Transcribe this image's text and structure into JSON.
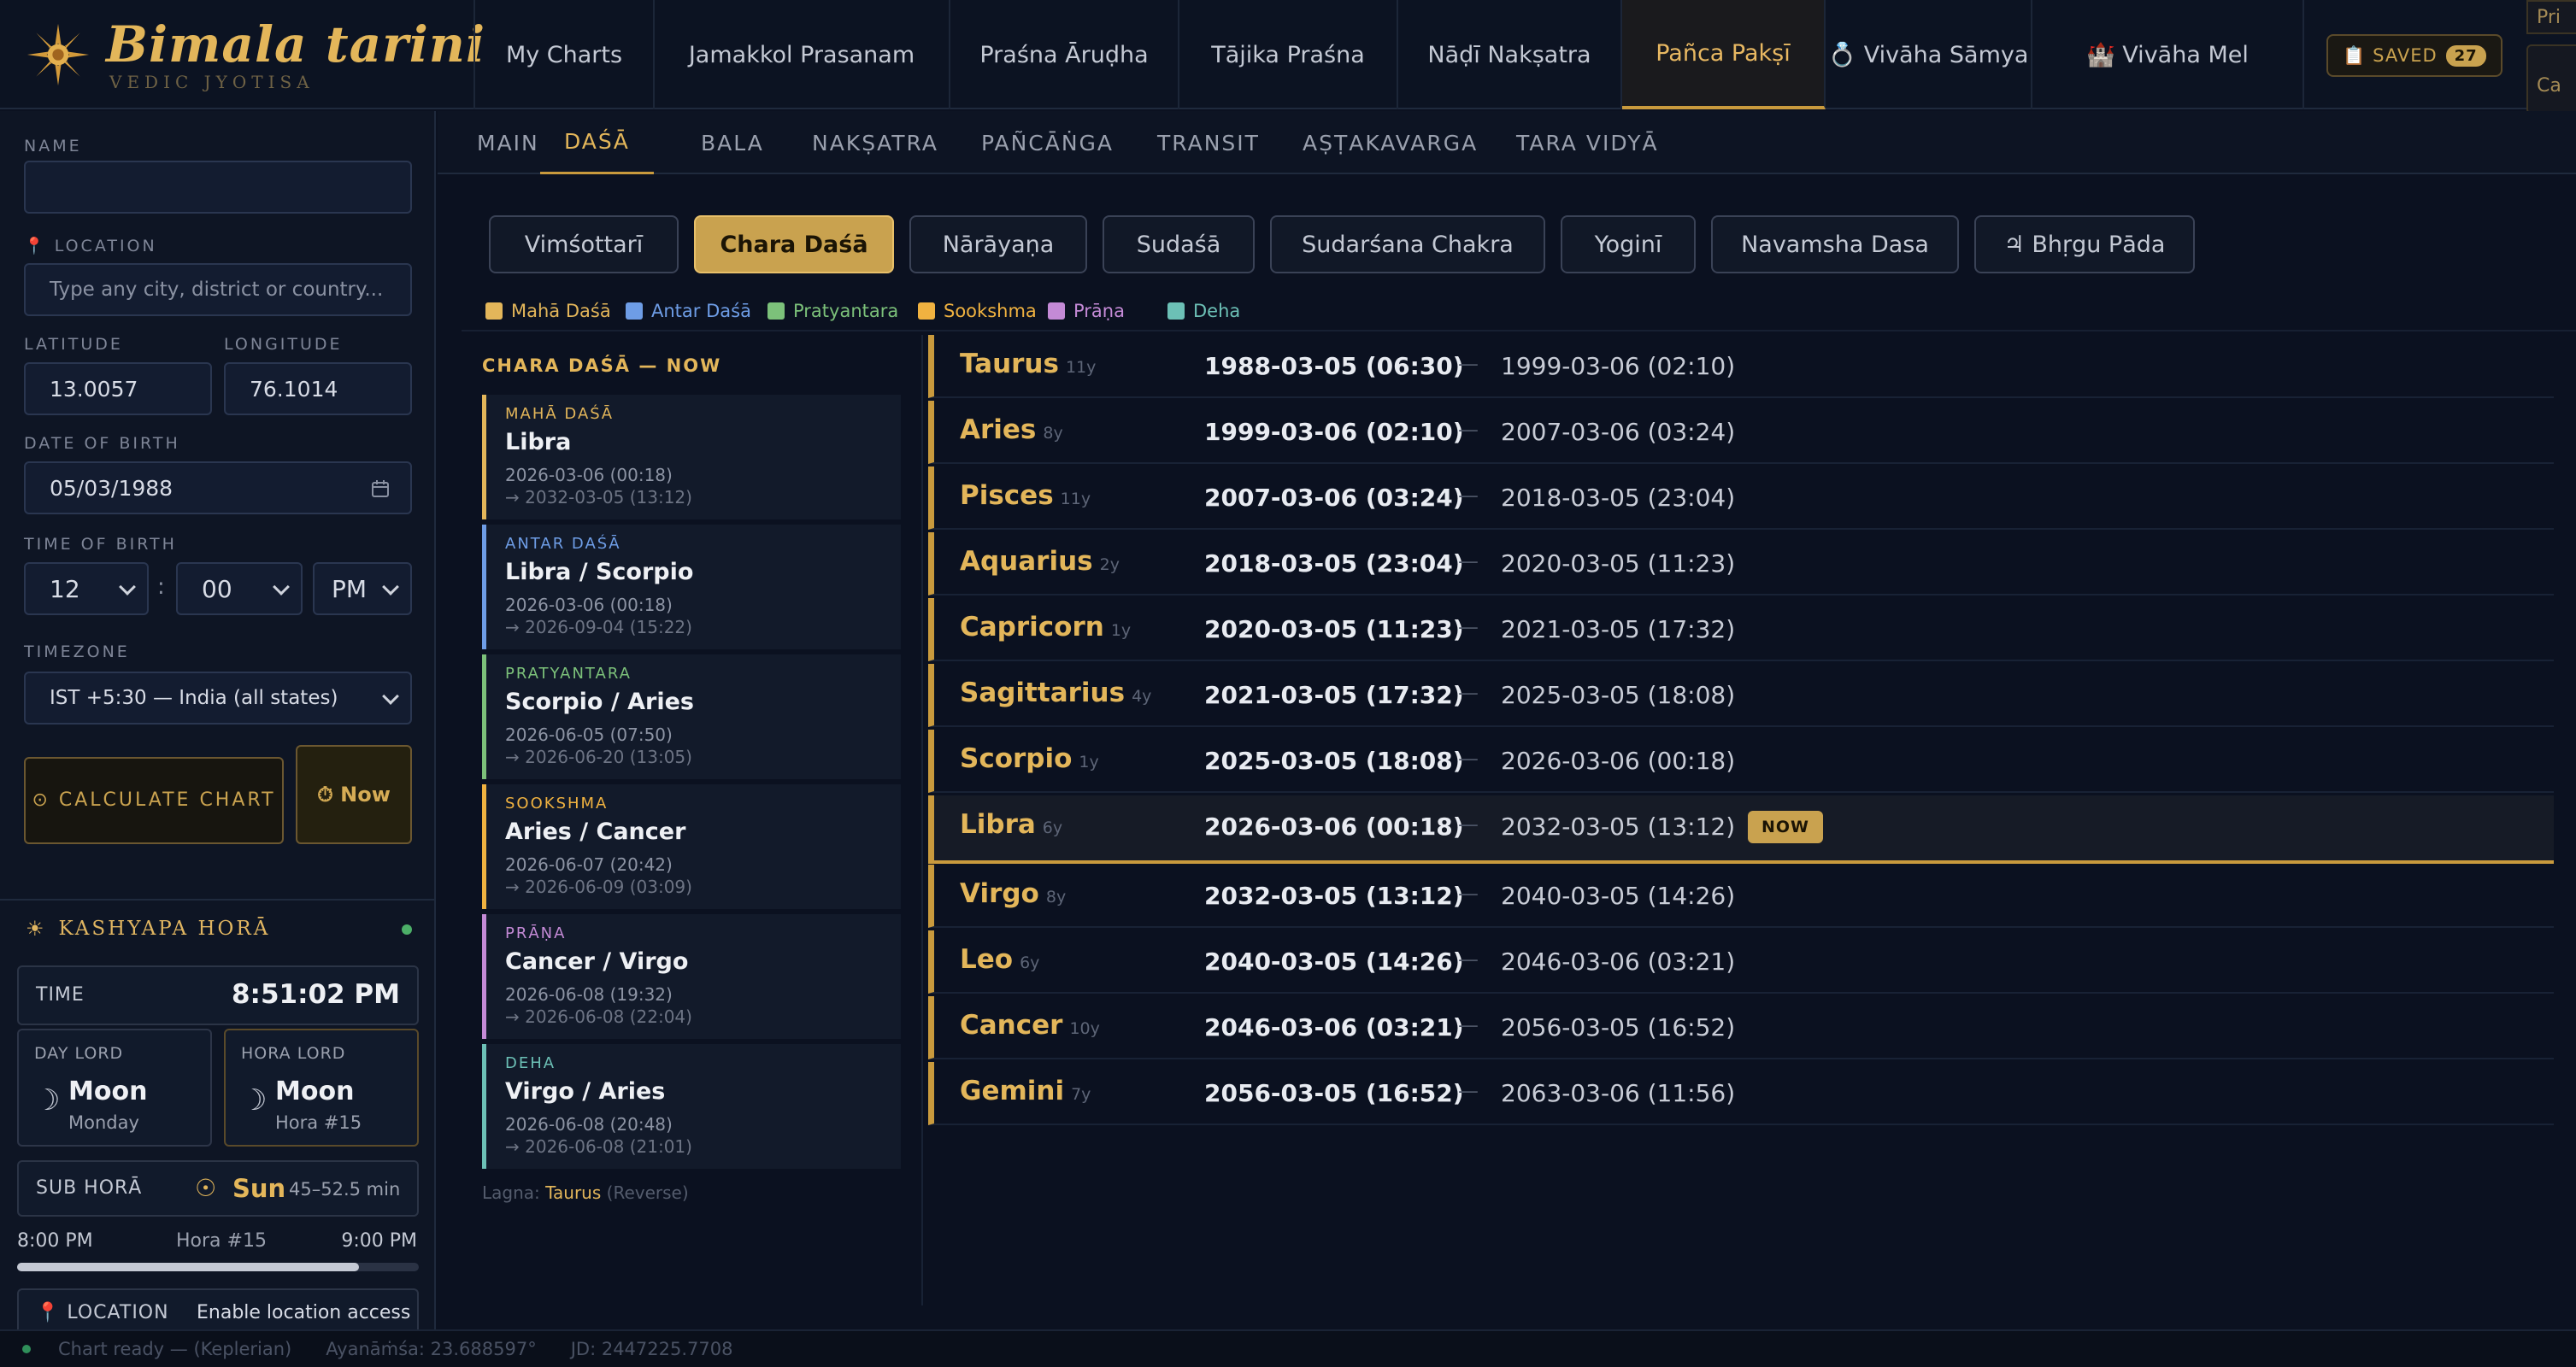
{
  "app": {
    "title": "Bimala tarini",
    "subtitle": "VEDIC JYOTISA"
  },
  "nav": [
    {
      "label": "My Charts"
    },
    {
      "label": "Jamakkol Prasanam"
    },
    {
      "label": "Praśna Āruḍha"
    },
    {
      "label": "Tājika Praśna"
    },
    {
      "label": "Nāḍī Nakṣatra"
    },
    {
      "label": "Pañca Pakṣī"
    },
    {
      "label": "💍 Vivāha Sāmya"
    },
    {
      "label": "🏰 Vivāha Mel"
    }
  ],
  "saved": {
    "label": "📋 SAVED",
    "count": "27"
  },
  "edge": {
    "top": "Pri",
    "bottom": "Ca"
  },
  "form": {
    "name_label": "NAME",
    "name_value": "",
    "location_label": "📍 LOCATION",
    "location_placeholder": "Type any city, district or country...",
    "latitude_label": "LATITUDE",
    "latitude_value": "13.0057",
    "longitude_label": "LONGITUDE",
    "longitude_value": "76.1014",
    "dob_label": "DATE OF BIRTH",
    "dob_value": "05/03/1988",
    "tob_label": "TIME OF BIRTH",
    "hour": "12",
    "minute": "00",
    "ampm": "PM",
    "colon": ":",
    "tz_label": "TIMEZONE",
    "tz_value": "IST +5:30 — India (all states)",
    "calc_label": "⊙ CALCULATE CHART",
    "now_label": "⏱ Now"
  },
  "hora": {
    "title": "KASHYAPA HORĀ",
    "time_label": "TIME",
    "time_value": "8:51:02 PM",
    "day_lord_label": "DAY LORD",
    "day_lord": "Moon",
    "day_lord_sub": "Monday",
    "hora_lord_label": "HORA LORD",
    "hora_lord": "Moon",
    "hora_lord_sub": "Hora #15",
    "sub_label": "SUB HORĀ",
    "sub_value": "Sun",
    "sub_range": "45–52.5 min",
    "start": "8:00 PM",
    "mid": "Hora #15",
    "end": "9:00 PM",
    "progress": 0.85,
    "loc_label": "📍 LOCATION",
    "loc_value": "Enable location access"
  },
  "subtabs": [
    "MAIN",
    "DAŚĀ",
    "BALA",
    "NAKṢATRA",
    "PAÑCĀṄGA",
    "TRANSIT",
    "AṢṬAKAVARGA",
    "TARA VIDYĀ"
  ],
  "dasa_buttons": [
    "Vimśottarī",
    "Chara Daśā",
    "Nārāyaṇa",
    "Sudaśā",
    "Sudarśana Chakra",
    "Yoginī",
    "Navamsha Dasa",
    "♃ Bhṛgu Pāda"
  ],
  "legend": [
    {
      "label": "Mahā Daśā",
      "color": "#e3b65a"
    },
    {
      "label": "Antar Daśā",
      "color": "#6e9de6"
    },
    {
      "label": "Pratyantara",
      "color": "#7cc17a"
    },
    {
      "label": "Sookshma",
      "color": "#f0b240"
    },
    {
      "label": "Prāṇa",
      "color": "#c48ad6"
    },
    {
      "label": "Deha",
      "color": "#6cc0b6"
    }
  ],
  "now_panel": {
    "title": "CHARA DAŚĀ — NOW",
    "cards": [
      {
        "level": "MAHĀ DAŚĀ",
        "name": "Libra",
        "start": "2026-03-06 (00:18)",
        "end": "→ 2032-03-05 (13:12)",
        "color": "#e3b65a"
      },
      {
        "level": "ANTAR DAŚĀ",
        "name": "Libra / Scorpio",
        "start": "2026-03-06 (00:18)",
        "end": "→ 2026-09-04 (15:22)",
        "color": "#6e9de6"
      },
      {
        "level": "PRATYANTARA",
        "name": "Scorpio / Aries",
        "start": "2026-06-05 (07:50)",
        "end": "→ 2026-06-20 (13:05)",
        "color": "#7cc17a"
      },
      {
        "level": "SOOKSHMA",
        "name": "Aries / Cancer",
        "start": "2026-06-07 (20:42)",
        "end": "→ 2026-06-09 (03:09)",
        "color": "#f0b240"
      },
      {
        "level": "PRĀṆA",
        "name": "Cancer / Virgo",
        "start": "2026-06-08 (19:32)",
        "end": "→ 2026-06-08 (22:04)",
        "color": "#c48ad6"
      },
      {
        "level": "DEHA",
        "name": "Virgo / Aries",
        "start": "2026-06-08 (20:48)",
        "end": "→ 2026-06-08 (21:01)",
        "color": "#6cc0b6"
      }
    ],
    "lagna_label": "Lagna:",
    "lagna_value": "Taurus",
    "lagna_note": "(Reverse)"
  },
  "dasa_rows": [
    {
      "sign": "Taurus",
      "years": "11y",
      "start": "1988-03-05 (06:30)",
      "end": "1999-03-06 (02:10)"
    },
    {
      "sign": "Aries",
      "years": "8y",
      "start": "1999-03-06 (02:10)",
      "end": "2007-03-06 (03:24)"
    },
    {
      "sign": "Pisces",
      "years": "11y",
      "start": "2007-03-06 (03:24)",
      "end": "2018-03-05 (23:04)"
    },
    {
      "sign": "Aquarius",
      "years": "2y",
      "start": "2018-03-05 (23:04)",
      "end": "2020-03-05 (11:23)"
    },
    {
      "sign": "Capricorn",
      "years": "1y",
      "start": "2020-03-05 (11:23)",
      "end": "2021-03-05 (17:32)"
    },
    {
      "sign": "Sagittarius",
      "years": "4y",
      "start": "2021-03-05 (17:32)",
      "end": "2025-03-05 (18:08)"
    },
    {
      "sign": "Scorpio",
      "years": "1y",
      "start": "2025-03-05 (18:08)",
      "end": "2026-03-06 (00:18)"
    },
    {
      "sign": "Libra",
      "years": "6y",
      "start": "2026-03-06 (00:18)",
      "end": "2032-03-05 (13:12)",
      "now": "NOW"
    },
    {
      "sign": "Virgo",
      "years": "8y",
      "start": "2032-03-05 (13:12)",
      "end": "2040-03-05 (14:26)"
    },
    {
      "sign": "Leo",
      "years": "6y",
      "start": "2040-03-05 (14:26)",
      "end": "2046-03-06 (03:21)"
    },
    {
      "sign": "Cancer",
      "years": "10y",
      "start": "2046-03-06 (03:21)",
      "end": "2056-03-05 (16:52)"
    },
    {
      "sign": "Gemini",
      "years": "7y",
      "start": "2056-03-05 (16:52)",
      "end": "2063-03-06 (11:56)"
    }
  ],
  "dash": "—",
  "status": {
    "ready": "Chart ready — (Keplerian)",
    "ayanamsa": "Ayanāṁśa: 23.688597°",
    "jd": "JD: 2447225.7708"
  }
}
